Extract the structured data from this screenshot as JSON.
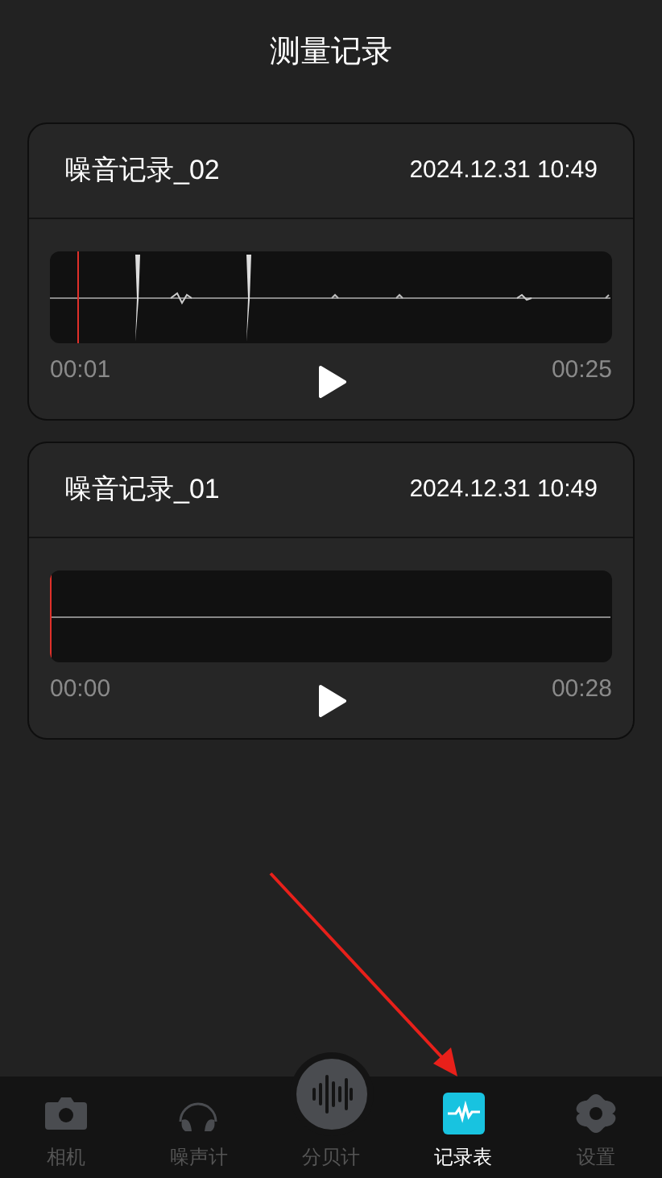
{
  "title": "测量记录",
  "recordings": [
    {
      "name": "噪音记录_02",
      "datetime": "2024.12.31 10:49",
      "kind": "waveform",
      "level": 0.05,
      "start": "00:01",
      "end": "00:25"
    },
    {
      "name": "噪音记录_01",
      "datetime": "2024.12.31 10:49",
      "kind": "silence",
      "level": 0,
      "start": "00:00",
      "end": "00:28"
    }
  ],
  "nav": [
    {
      "label": "相机",
      "kind": "camera",
      "selected": false
    },
    {
      "label": "噪声计",
      "kind": "headphones",
      "selected": false
    },
    {
      "label": "分贝计",
      "kind": "wave",
      "selected": false
    },
    {
      "label": "记录表",
      "kind": "record",
      "selected": true
    },
    {
      "label": "设置",
      "kind": "gear",
      "selected": false
    }
  ]
}
